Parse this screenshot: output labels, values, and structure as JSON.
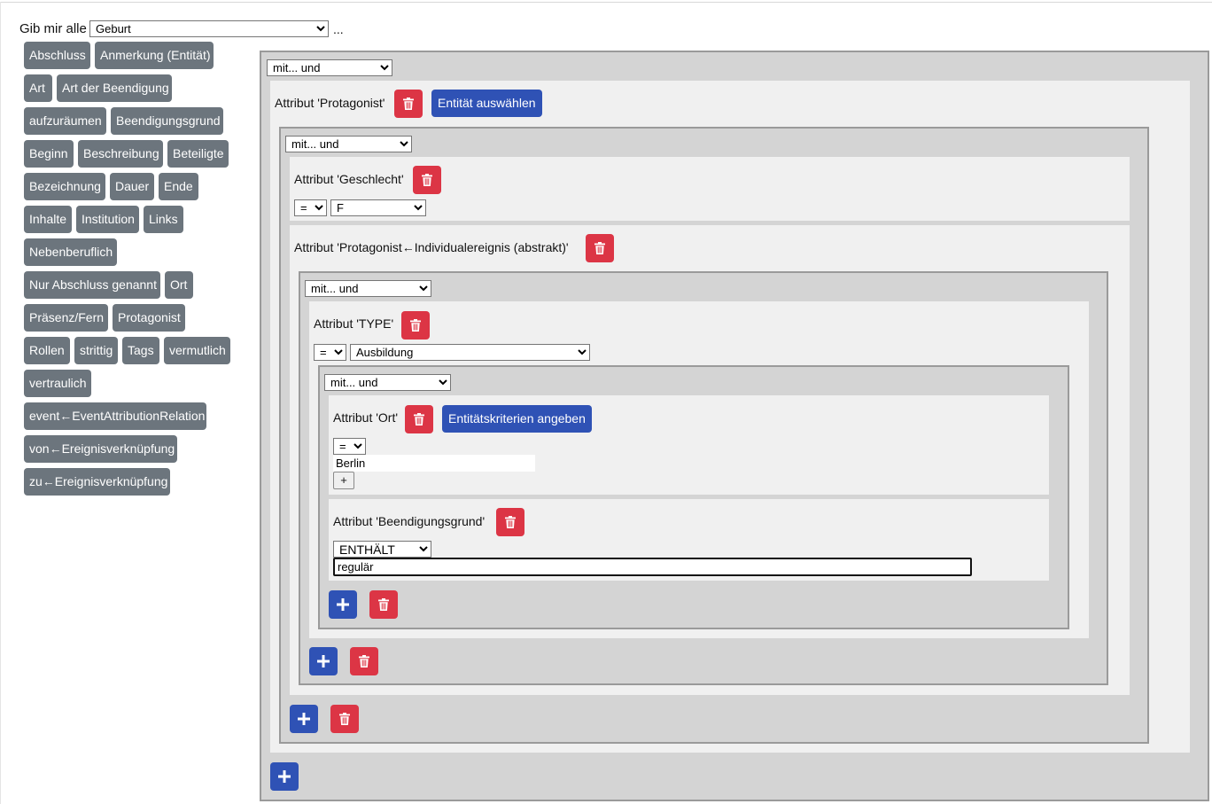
{
  "query": {
    "prefix": "Gib mir alle",
    "entity_type": "Geburt",
    "suffix": "..."
  },
  "attributes": [
    "Abschluss",
    "Anmerkung (Entität)",
    "Art",
    "Art der Beendigung",
    "aufzuräumen",
    "Beendigungsgrund",
    "Beginn",
    "Beschreibung",
    "Beteiligte",
    "Bezeichnung",
    "Dauer",
    "Ende",
    "Inhalte",
    "Institution",
    "Links",
    "Nebenberuflich",
    "Nur Abschluss genannt",
    "Ort",
    "Präsenz/Fern",
    "Protagonist",
    "Rollen",
    "strittig",
    "Tags",
    "vermutlich",
    "vertraulich",
    "event←EventAttributionRelation",
    "von←Ereignisverknüpfung",
    "zu←Ereignisverknüpfung"
  ],
  "builder": {
    "root_mode": "mit... und",
    "protagonist": {
      "label": "Attribut 'Protagonist'",
      "select_entity_label": "Entität auswählen",
      "mode": "mit... und",
      "geschlecht": {
        "label": "Attribut 'Geschlecht'",
        "operator": "=",
        "value": "F"
      },
      "individual": {
        "label": "Attribut 'Protagonist←Individualereignis (abstrakt)'",
        "mode": "mit... und",
        "type": {
          "label": "Attribut 'TYPE'",
          "operator": "=",
          "value": "Ausbildung"
        },
        "inner_mode": "mit... und",
        "ort": {
          "label": "Attribut 'Ort'",
          "criteria_label": "Entitätskriterien angeben",
          "operator": "=",
          "value": "Berlin",
          "add_label": "+"
        },
        "beendigungsgrund": {
          "label": "Attribut 'Beendigungsgrund'",
          "operator": "ENTHÄLT",
          "value": "regulär"
        }
      }
    }
  },
  "colors": {
    "danger": "#dc3545",
    "primary": "#2f52b5",
    "chip": "#6c757d"
  },
  "icons": {
    "delete": "trash-icon",
    "add": "plus-icon"
  }
}
